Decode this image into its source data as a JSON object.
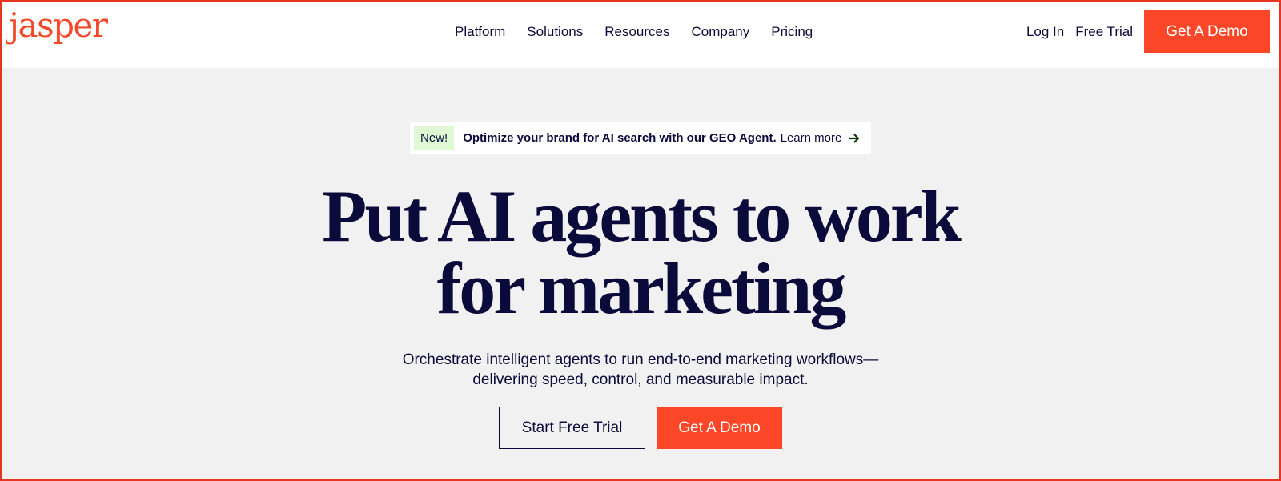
{
  "brand": {
    "logo_text": "jasper",
    "accent_color": "#fb4627",
    "text_color": "#0b0b3b"
  },
  "nav": {
    "links": [
      "Platform",
      "Solutions",
      "Resources",
      "Company",
      "Pricing"
    ],
    "login_label": "Log In",
    "free_trial_label": "Free Trial",
    "demo_label": "Get A Demo"
  },
  "announcement": {
    "badge": "New!",
    "message": "Optimize your brand for AI search with our GEO Agent.",
    "link_label": "Learn more",
    "icon": "arrow-right-icon"
  },
  "hero": {
    "headline_line1": "Put AI agents to work",
    "headline_line2": "for marketing",
    "subtitle_line1": "Orchestrate intelligent agents to run end-to-end marketing workflows—",
    "subtitle_line2": "delivering speed, control, and measurable impact.",
    "primary_cta": "Start Free Trial",
    "secondary_cta": "Get A Demo"
  }
}
